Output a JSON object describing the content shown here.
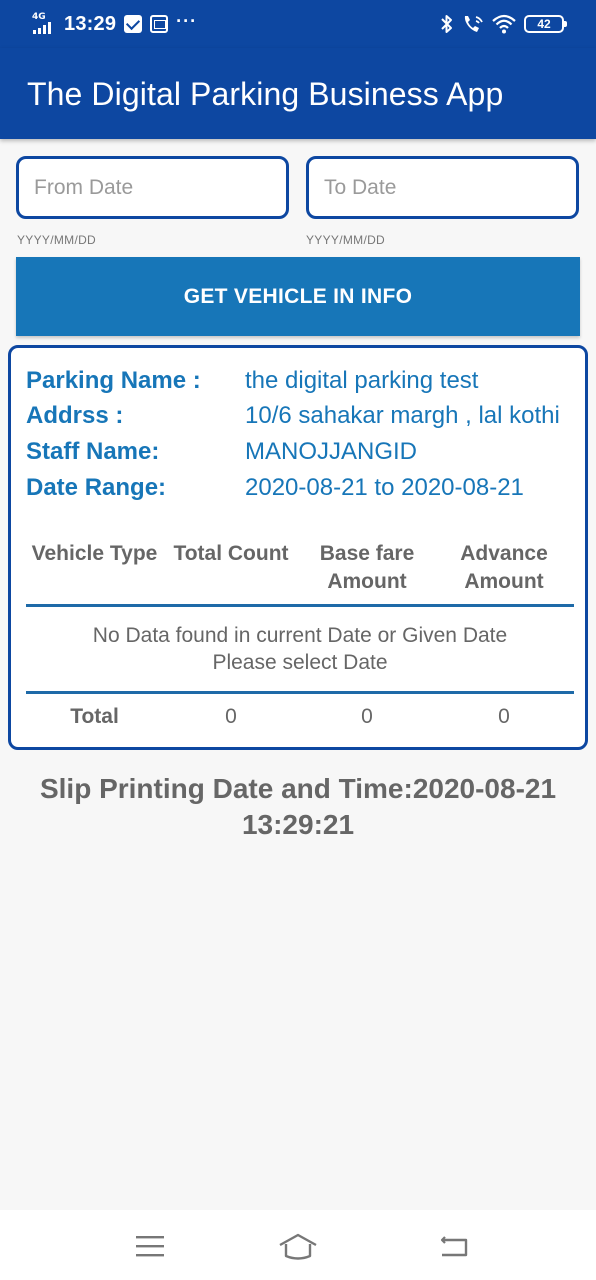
{
  "status_bar": {
    "network": "4G",
    "time": "13:29",
    "more": "···",
    "battery": "42"
  },
  "app": {
    "title": "The Digital Parking Business App"
  },
  "filters": {
    "from_placeholder": "From Date",
    "from_value": "",
    "from_hint": "YYYY/MM/DD",
    "to_placeholder": "To Date",
    "to_value": "",
    "to_hint": "YYYY/MM/DD",
    "button_label": "GET VEHICLE IN INFO"
  },
  "info": {
    "rows": [
      {
        "label": "Parking Name :",
        "value": "the digital parking test"
      },
      {
        "label": "Addrss :",
        "value": "10/6 sahakar margh , lal kothi"
      },
      {
        "label": "Staff Name:",
        "value": "MANOJJANGID"
      },
      {
        "label": "Date Range:",
        "value": "2020-08-21 to 2020-08-21"
      }
    ]
  },
  "table": {
    "headers": [
      {
        "line1": "Vehicle Type",
        "line2": ""
      },
      {
        "line1": "Total Count",
        "line2": ""
      },
      {
        "line1": "Base fare",
        "line2": "Amount"
      },
      {
        "line1": "Advance",
        "line2": "Amount"
      }
    ],
    "empty_line1": "No Data found in current Date or Given Date",
    "empty_line2": "Please select Date",
    "total": {
      "label": "Total",
      "count": "0",
      "base_fare": "0",
      "advance": "0"
    }
  },
  "slip": {
    "line1": "Slip Printing Date and Time:2020-08-21",
    "line2": "13:29:21"
  },
  "colors": {
    "primary": "#0d47a1",
    "accent": "#1776b8",
    "text_muted": "#666666"
  },
  "icons": [
    "bluetooth-icon",
    "wifi-call-icon",
    "wifi-icon",
    "battery-icon",
    "menu-icon",
    "home-icon",
    "back-icon"
  ]
}
